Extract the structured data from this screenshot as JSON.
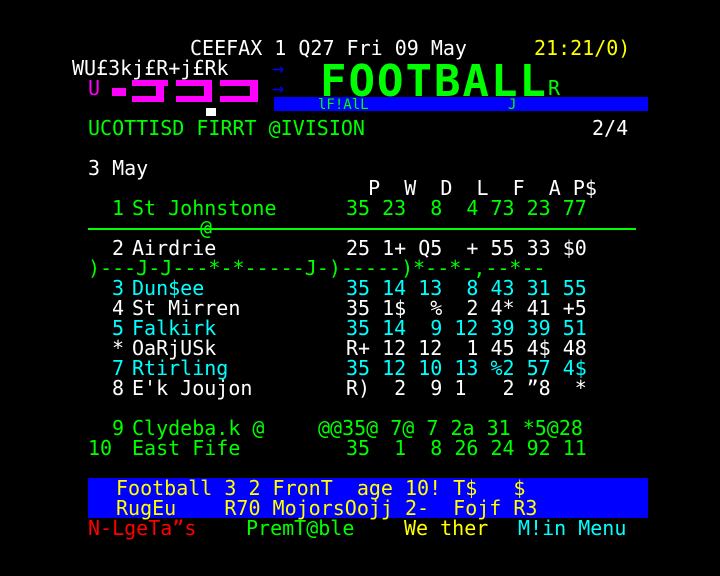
{
  "header": {
    "service": "CEEFAX 1 Q27 Fri 09 May",
    "clock": "21:21/0)",
    "garbled_line": "WU£3kj£R+j£Rk",
    "arrow_1": "→",
    "arrow_2": "→",
    "mosaic_prefix": "U",
    "mosaic_fragment_1": "lF!AlL",
    "mosaic_fragment_2": "J",
    "mosaic_fragment_3": "R"
  },
  "logo": {
    "text": "FOOTBALL"
  },
  "section_title": "UCOTTISD FIRRT @IVISION",
  "page_counter": "2/4",
  "date": "3 May",
  "table": {
    "header": "   P  W  D  L  F  A P$",
    "rows": [
      {
        "pos": " 1",
        "team": "St Johnstone",
        "stats": "35 23  8  4 73 23 77",
        "color": "g"
      },
      {
        "pos": " 2",
        "team": "Airdrie",
        "stats": "25 1+ Q5  + 55 33 $0",
        "color": "w"
      },
      {
        "pos": " 3",
        "team": "Dun$ee",
        "stats": "35 14 13  8 43 31 55",
        "color": "c"
      },
      {
        "pos": " 4",
        "team": "St Mirren",
        "stats": "35 1$  %  2 4* 41 +5",
        "color": "w"
      },
      {
        "pos": " 5",
        "team": "Falkirk",
        "stats": "35 14  9 12 39 39 51",
        "color": "c"
      },
      {
        "pos": " *",
        "team": "OaRjUSk",
        "stats": "R+ 12 12  1 45 4$ 48",
        "color": "w"
      },
      {
        "pos": " 7",
        "team": "Rtirling",
        "stats": "35 12 10 13 %2 57 4$",
        "color": "c"
      },
      {
        "pos": " 8",
        "team": "E'k Joujon",
        "stats": "R)  2  9 1   2 ”8  *",
        "color": "w"
      },
      {
        "pos": " 9",
        "team": "Clydeba.k @",
        "stats": "@@35@ 7@ 7 2a 31 *5@28",
        "color": "g"
      },
      {
        "pos": "10",
        "team": "East Fife",
        "stats": "35  1  8 26 24 92 11",
        "color": "g"
      }
    ],
    "separator_1_text": "@",
    "separator_2_text": ")---J-J---*-*-----J-)-----)*--*-,--*--"
  },
  "footer": {
    "line1": "Football 3 2 FronT  age 10! T$   $",
    "line2": "RugEu    R70 MojorsOojj 2-  Fojf R3",
    "fastext": [
      {
        "label": "N-LgeTa”s",
        "color": "#ff0000"
      },
      {
        "label": "PremT@ble",
        "color": "#00ff00"
      },
      {
        "label": "We ther",
        "color": "#ffff00"
      },
      {
        "label": "M!in Menu",
        "color": "#00ffff"
      }
    ]
  }
}
